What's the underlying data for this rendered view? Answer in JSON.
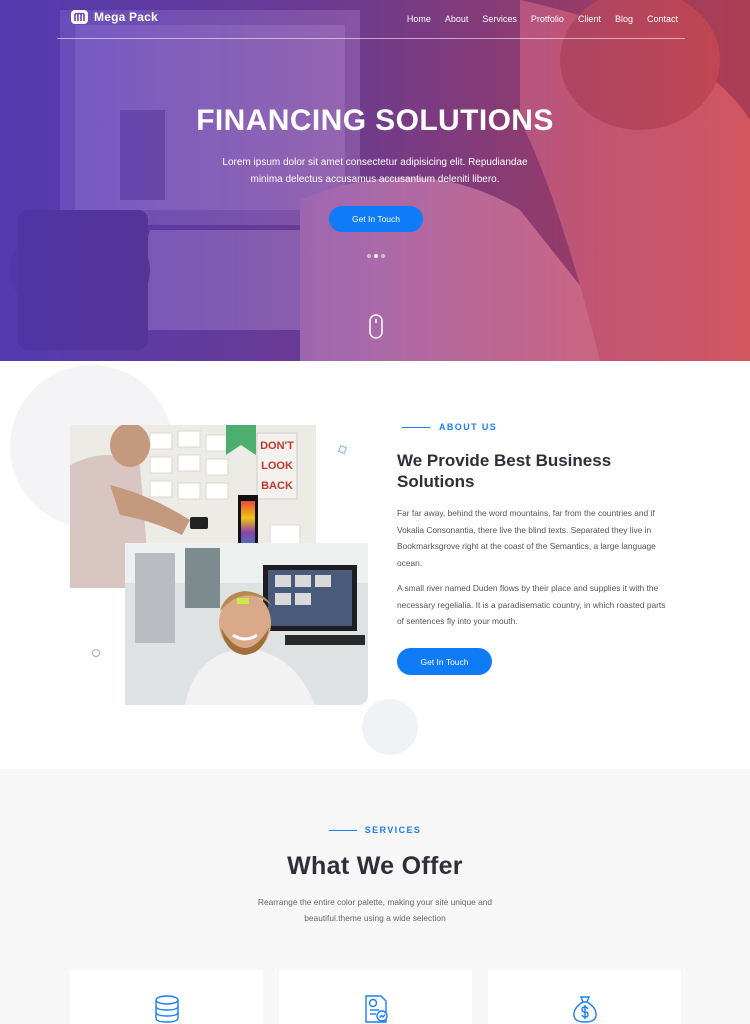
{
  "nav": {
    "brand": "Mega Pack",
    "items": [
      "Home",
      "About",
      "Services",
      "Protfolio",
      "Client",
      "Blog",
      "Contact"
    ]
  },
  "hero": {
    "title": "FINANCING SOLUTIONS",
    "subtitle": "Lorem ipsum dolor sit amet consectetur adipisicing elit. Repudiandae minima delectus accusamus accusantium deleniti libero.",
    "button": "Get In Touch",
    "slides": 3,
    "active_slide": 2
  },
  "about": {
    "kicker": "ABOUT US",
    "title": "We Provide Best Business Solutions",
    "paragraph1": "Far far away, behind the word mountains, far from the countries and if Vokalia Consonantia, there live the blind texts. Separated they live in Bookmarksgrove right at the coast of the Semantics, a large language ocean.",
    "paragraph2": "A small river named Duden flows by their place and supplies it with the necessary regelialia. It is a paradisematic country, in which roasted parts of sentences fly into your mouth.",
    "button": "Get In Touch",
    "photo_sign": "DON'T LOOK BACK"
  },
  "services": {
    "kicker": "SERVICES",
    "title": "What We Offer",
    "description": "Rearrange the entire color palette, making your site unique and beautiful.theme using a wide selection",
    "cards": [
      {
        "icon": "database-icon"
      },
      {
        "icon": "document-chart-icon"
      },
      {
        "icon": "money-bag-icon"
      }
    ]
  },
  "colors": {
    "accent": "#0f7bf6",
    "hero_gradient_start": "#5a3cc0",
    "hero_gradient_end": "#d4424e",
    "heading": "#2d3038"
  }
}
